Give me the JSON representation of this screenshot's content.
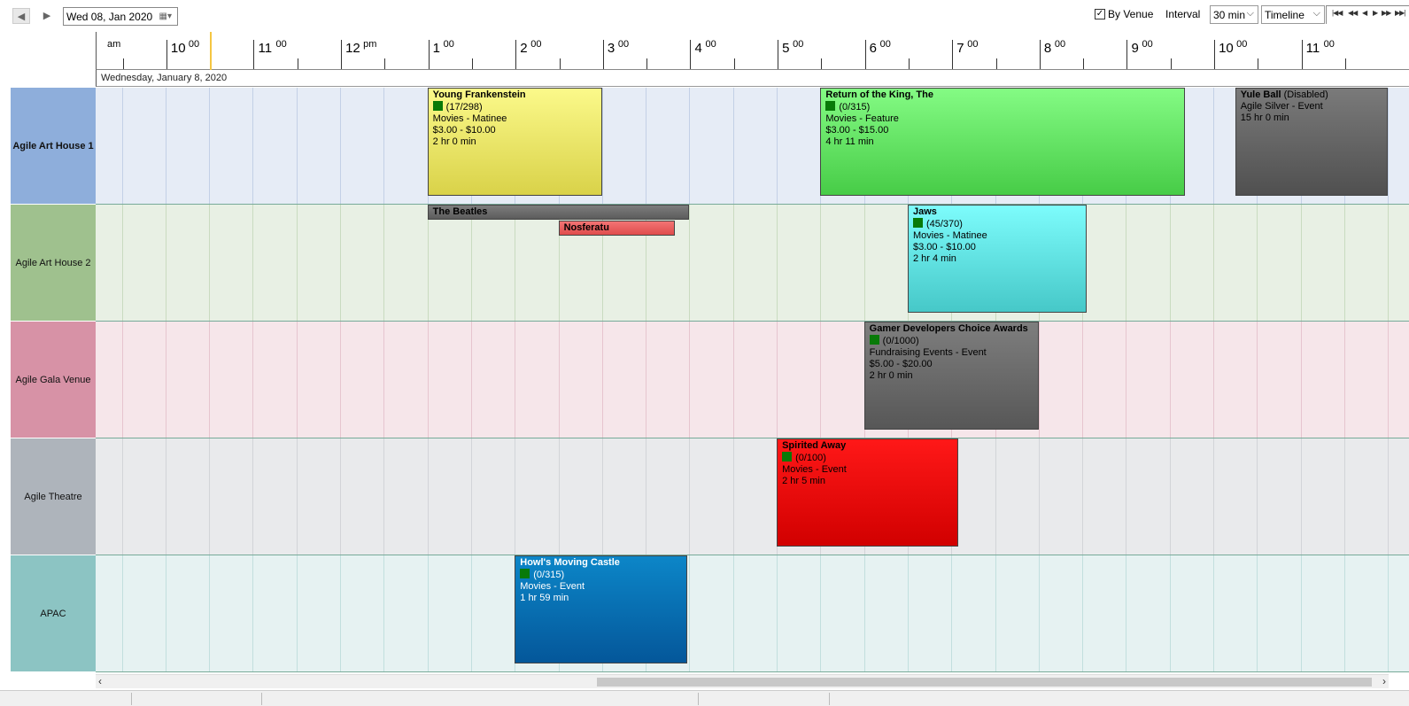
{
  "toolbar": {
    "prev_icon": "triangle-left",
    "next_icon": "triangle-right",
    "date_value": "Wed 08, Jan  2020",
    "by_venue_label": "By Venue",
    "by_venue_checked": true,
    "interval_label": "Interval",
    "interval_value": "30 min",
    "view_value": "Timeline"
  },
  "ruler": {
    "hours": [
      {
        "num": "10",
        "sup": "00"
      },
      {
        "num": "11",
        "sup": "00"
      },
      {
        "num": "12",
        "sup": "pm"
      },
      {
        "num": "1",
        "sup": "00"
      },
      {
        "num": "2",
        "sup": "00"
      },
      {
        "num": "3",
        "sup": "00"
      },
      {
        "num": "4",
        "sup": "00"
      },
      {
        "num": "5",
        "sup": "00"
      },
      {
        "num": "6",
        "sup": "00"
      },
      {
        "num": "7",
        "sup": "00"
      },
      {
        "num": "8",
        "sup": "00"
      },
      {
        "num": "9",
        "sup": "00"
      },
      {
        "num": "10",
        "sup": "00"
      },
      {
        "num": "11",
        "sup": "00"
      }
    ],
    "am_label": "am",
    "date_label": "Wednesday, January 8, 2020"
  },
  "venues": [
    {
      "name": "Agile Art House 1",
      "bold": true,
      "label_color": "#8eaedb",
      "row_color": "#e6ecf6",
      "grid_color": "#c3d0e6"
    },
    {
      "name": "Agile Art House 2",
      "bold": false,
      "label_color": "#9fc18e",
      "row_color": "#e8f0e4",
      "grid_color": "#c9dbc0"
    },
    {
      "name": "Agile Gala Venue",
      "bold": false,
      "label_color": "#d792a6",
      "row_color": "#f6e6ea",
      "grid_color": "#e6c5cf"
    },
    {
      "name": "Agile Theatre",
      "bold": false,
      "label_color": "#aeb4bb",
      "row_color": "#e9eaec",
      "grid_color": "#d2d4d8"
    },
    {
      "name": "APAC",
      "bold": false,
      "label_color": "#8cc4c3",
      "row_color": "#e6f2f2",
      "grid_color": "#c2dfde"
    }
  ],
  "events": [
    {
      "venue": 0,
      "start": 13.0,
      "end": 15.0,
      "title": "Young Frankenstein",
      "count": "(17/298)",
      "lines": [
        "Movies - Matinee",
        "$3.00 - $10.00",
        "2 hr 0 min"
      ],
      "bg_top": "#fbf98a",
      "bg_bottom": "#d9d249",
      "text": "#000"
    },
    {
      "venue": 0,
      "start": 17.5,
      "end": 21.67,
      "title": "Return of the King, The",
      "count": "(0/315)",
      "lines": [
        "Movies - Feature",
        "$3.00 - $15.00",
        "4 hr 11 min"
      ],
      "bg_top": "#84fb84",
      "bg_bottom": "#47cc47",
      "text": "#000"
    },
    {
      "venue": 0,
      "start": 22.25,
      "end": 24.0,
      "title": "Yule Ball",
      "title_suffix": " (Disabled)",
      "lines": [
        "Agile Silver - Event",
        "15 hr 0 min"
      ],
      "bg_top": "#7a7a7a",
      "bg_bottom": "#505050",
      "text": "#000"
    },
    {
      "venue": 1,
      "start": 13.0,
      "end": 16.0,
      "title": "The Beatles",
      "lines": [],
      "bg_top": "#7d7d7d",
      "bg_bottom": "#5c5c5c",
      "text": "#000",
      "short": true
    },
    {
      "venue": 1,
      "start": 14.5,
      "end": 15.83,
      "title": "Nosferatu",
      "lines": [],
      "bg_top": "#f37474",
      "bg_bottom": "#e04c4c",
      "text": "#000",
      "short": true,
      "offset": 18
    },
    {
      "venue": 1,
      "start": 18.5,
      "end": 20.55,
      "title": "Jaws",
      "count": "(45/370)",
      "lines": [
        "Movies - Matinee",
        "$3.00 - $10.00",
        "2 hr 4 min"
      ],
      "bg_top": "#7dfcfc",
      "bg_bottom": "#46c8c8",
      "text": "#000"
    },
    {
      "venue": 2,
      "start": 18.0,
      "end": 20.0,
      "title": "Gamer Developers Choice Awards",
      "count": "(0/1000)",
      "lines": [
        "Fundraising Events - Event",
        "$5.00 - $20.00",
        "2 hr 0 min"
      ],
      "bg_top": "#7e7e7e",
      "bg_bottom": "#575757",
      "text": "#000"
    },
    {
      "venue": 3,
      "start": 17.0,
      "end": 19.08,
      "title": "Spirited Away",
      "count": "(0/100)",
      "lines": [
        "Movies - Event",
        "2 hr 5 min"
      ],
      "bg_top": "#ff1818",
      "bg_bottom": "#d10000",
      "text": "#000"
    },
    {
      "venue": 4,
      "start": 14.0,
      "end": 15.98,
      "title": "Howl's Moving Castle",
      "count": "(0/315)",
      "lines": [
        "Movies - Event",
        "1 hr 59 min"
      ],
      "bg_top": "#0c86c8",
      "bg_bottom": "#04579a",
      "text": "#fff"
    }
  ]
}
